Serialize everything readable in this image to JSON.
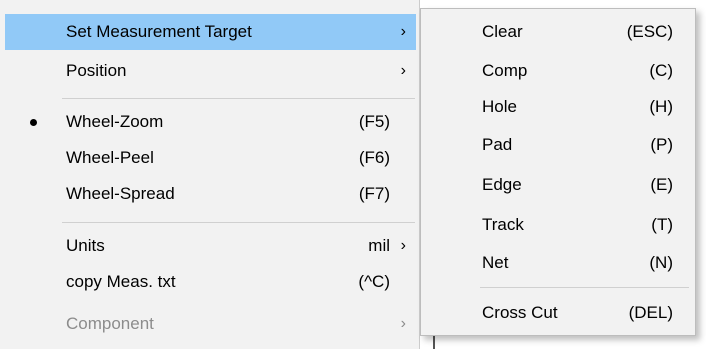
{
  "main_menu": {
    "items": [
      {
        "label": "Set Measurement Target",
        "shortcut": "",
        "arrow": "›",
        "highlighted": true,
        "checked": false,
        "disabled": false
      },
      {
        "label": "Position",
        "shortcut": "",
        "arrow": "›",
        "highlighted": false,
        "checked": false,
        "disabled": false
      },
      {
        "label": "Wheel-Zoom",
        "shortcut": "(F5)",
        "arrow": "",
        "highlighted": false,
        "checked": true,
        "disabled": false
      },
      {
        "label": "Wheel-Peel",
        "shortcut": "(F6)",
        "arrow": "",
        "highlighted": false,
        "checked": false,
        "disabled": false
      },
      {
        "label": "Wheel-Spread",
        "shortcut": "(F7)",
        "arrow": "",
        "highlighted": false,
        "checked": false,
        "disabled": false
      },
      {
        "label": "Units",
        "shortcut": "mil",
        "arrow": "›",
        "highlighted": false,
        "checked": false,
        "disabled": false
      },
      {
        "label": "copy Meas. txt",
        "shortcut": "(^C)",
        "arrow": "",
        "highlighted": false,
        "checked": false,
        "disabled": false
      },
      {
        "label": "Component",
        "shortcut": "",
        "arrow": "›",
        "highlighted": false,
        "checked": false,
        "disabled": true
      }
    ]
  },
  "sub_menu": {
    "items": [
      {
        "label": "Clear",
        "shortcut": "(ESC)"
      },
      {
        "label": "Comp",
        "shortcut": "(C)"
      },
      {
        "label": "Hole",
        "shortcut": "(H)"
      },
      {
        "label": "Pad",
        "shortcut": "(P)"
      },
      {
        "label": "Edge",
        "shortcut": "(E)"
      },
      {
        "label": "Track",
        "shortcut": "(T)"
      },
      {
        "label": "Net",
        "shortcut": "(N)"
      },
      {
        "label": "Cross Cut",
        "shortcut": "(DEL)"
      }
    ]
  },
  "colors": {
    "highlight": "#91c9f7",
    "menu_background": "#f2f2f2",
    "disabled_text": "#8c8c8c"
  },
  "icons": {
    "submenu_arrow": "chevron-right-icon",
    "check_bullet": "bullet-icon"
  }
}
